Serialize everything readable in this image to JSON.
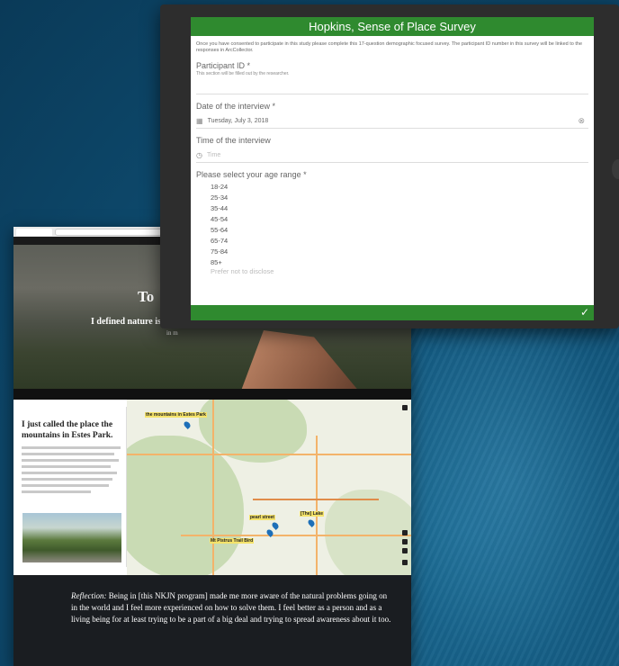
{
  "survey": {
    "title": "Hopkins, Sense of Place Survey",
    "intro": "Once you have consented to participate in this study please complete this 17-question demographic focused survey. The participant ID number in this survey will be linked to the responses in ArcCollector.",
    "participant_label": "Participant ID *",
    "participant_hint": "This section will be filled out by the researcher.",
    "date_label": "Date of the interview *",
    "date_value": "Tuesday, July 3, 2018",
    "time_label": "Time of the interview",
    "time_placeholder": "Time",
    "age_label": "Please select your age range *",
    "age_options": [
      "18-24",
      "25-34",
      "35-44",
      "45-54",
      "55-64",
      "65-74",
      "75-84",
      "85+"
    ],
    "age_cut": "Prefer not to disclose",
    "calendar_icon": "calendar-icon",
    "clock_icon": "clock-icon",
    "submit_icon": "check-icon",
    "accent": "#2f8a2f"
  },
  "story": {
    "hero_title": "To",
    "hero_sub": "I defined nature is",
    "hero_sub2": "in m",
    "side_title": "I just called the place the mountains in Estes Park.",
    "map_labels": {
      "estes": "the mountains in Estes Park",
      "pearl": "pearl street",
      "lake": "[The] Lake",
      "ptrail": "Mt Pistrus Trail Bird"
    },
    "reflection_lead": "Reflection:",
    "reflection_text": "Being in [this NKJN program] made me more aware of the natural problems going on in the world and I feel more experienced on how to solve them. I feel better as a person and as a living being for at least trying to be a part of a big deal and trying to spread awareness about it too."
  }
}
